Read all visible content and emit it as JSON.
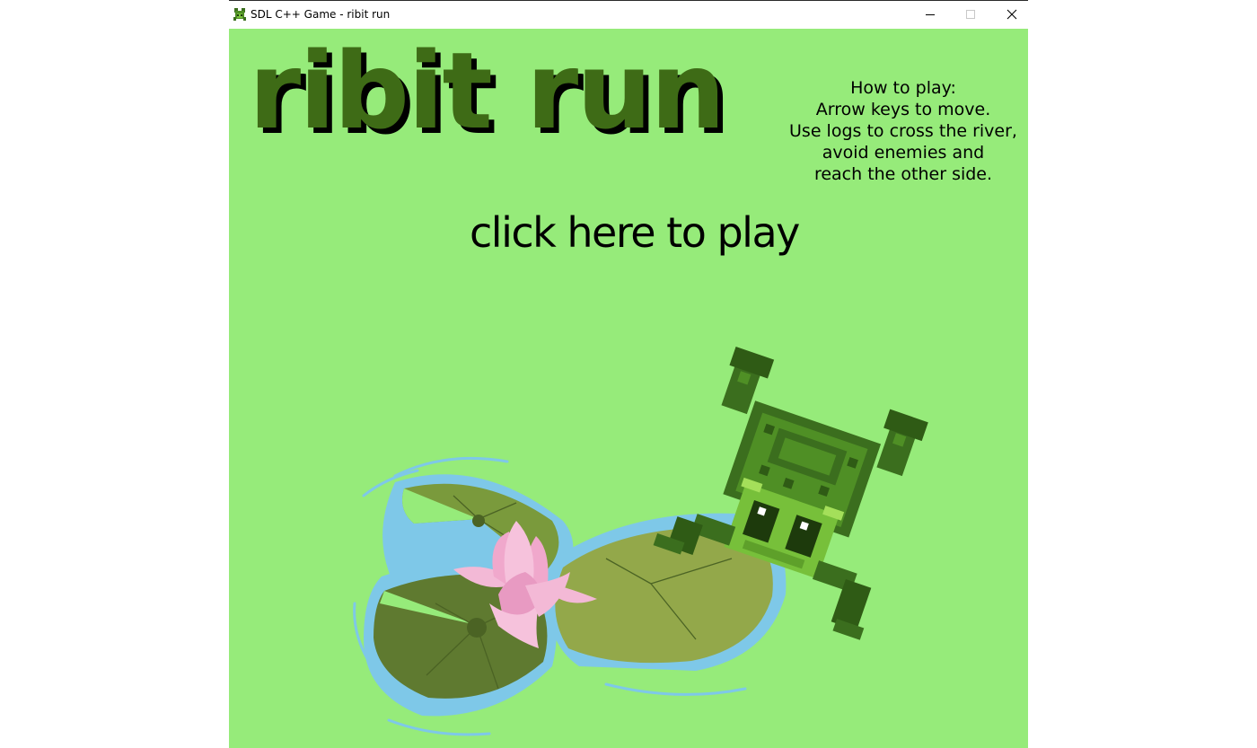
{
  "window": {
    "title": "SDL C++ Game - ribit run",
    "app_icon": "frog-icon",
    "controls": [
      "minimize-icon",
      "maximize-icon",
      "close-icon"
    ]
  },
  "game": {
    "title": "ribit run",
    "how_to_play": {
      "heading": "How to play:",
      "lines": [
        "Arrow keys to move.",
        "Use logs to cross the river,",
        "avoid enemies and",
        "reach the other side."
      ]
    },
    "play_label": "click here to play",
    "colors": {
      "background": "#96eb7a",
      "title_fill": "#3e6b16",
      "title_shadow": "#000000"
    }
  }
}
